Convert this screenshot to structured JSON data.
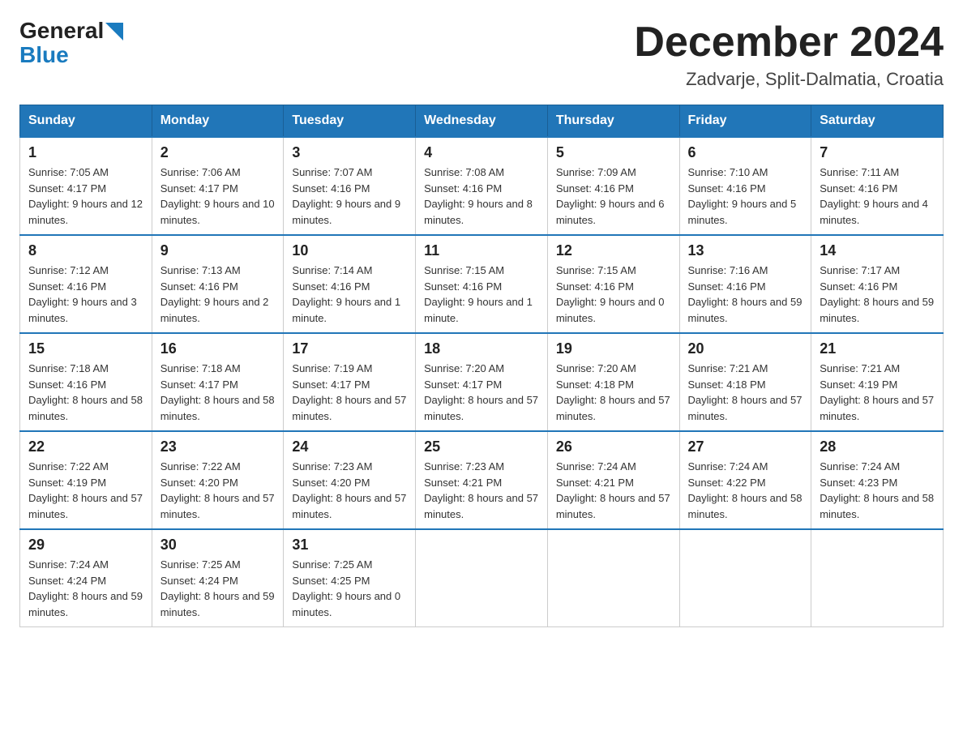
{
  "header": {
    "logo_general": "General",
    "logo_blue": "Blue",
    "title": "December 2024",
    "location": "Zadvarje, Split-Dalmatia, Croatia"
  },
  "days_of_week": [
    "Sunday",
    "Monday",
    "Tuesday",
    "Wednesday",
    "Thursday",
    "Friday",
    "Saturday"
  ],
  "weeks": [
    [
      {
        "day": "1",
        "sunrise": "7:05 AM",
        "sunset": "4:17 PM",
        "daylight": "9 hours and 12 minutes."
      },
      {
        "day": "2",
        "sunrise": "7:06 AM",
        "sunset": "4:17 PM",
        "daylight": "9 hours and 10 minutes."
      },
      {
        "day": "3",
        "sunrise": "7:07 AM",
        "sunset": "4:16 PM",
        "daylight": "9 hours and 9 minutes."
      },
      {
        "day": "4",
        "sunrise": "7:08 AM",
        "sunset": "4:16 PM",
        "daylight": "9 hours and 8 minutes."
      },
      {
        "day": "5",
        "sunrise": "7:09 AM",
        "sunset": "4:16 PM",
        "daylight": "9 hours and 6 minutes."
      },
      {
        "day": "6",
        "sunrise": "7:10 AM",
        "sunset": "4:16 PM",
        "daylight": "9 hours and 5 minutes."
      },
      {
        "day": "7",
        "sunrise": "7:11 AM",
        "sunset": "4:16 PM",
        "daylight": "9 hours and 4 minutes."
      }
    ],
    [
      {
        "day": "8",
        "sunrise": "7:12 AM",
        "sunset": "4:16 PM",
        "daylight": "9 hours and 3 minutes."
      },
      {
        "day": "9",
        "sunrise": "7:13 AM",
        "sunset": "4:16 PM",
        "daylight": "9 hours and 2 minutes."
      },
      {
        "day": "10",
        "sunrise": "7:14 AM",
        "sunset": "4:16 PM",
        "daylight": "9 hours and 1 minute."
      },
      {
        "day": "11",
        "sunrise": "7:15 AM",
        "sunset": "4:16 PM",
        "daylight": "9 hours and 1 minute."
      },
      {
        "day": "12",
        "sunrise": "7:15 AM",
        "sunset": "4:16 PM",
        "daylight": "9 hours and 0 minutes."
      },
      {
        "day": "13",
        "sunrise": "7:16 AM",
        "sunset": "4:16 PM",
        "daylight": "8 hours and 59 minutes."
      },
      {
        "day": "14",
        "sunrise": "7:17 AM",
        "sunset": "4:16 PM",
        "daylight": "8 hours and 59 minutes."
      }
    ],
    [
      {
        "day": "15",
        "sunrise": "7:18 AM",
        "sunset": "4:16 PM",
        "daylight": "8 hours and 58 minutes."
      },
      {
        "day": "16",
        "sunrise": "7:18 AM",
        "sunset": "4:17 PM",
        "daylight": "8 hours and 58 minutes."
      },
      {
        "day": "17",
        "sunrise": "7:19 AM",
        "sunset": "4:17 PM",
        "daylight": "8 hours and 57 minutes."
      },
      {
        "day": "18",
        "sunrise": "7:20 AM",
        "sunset": "4:17 PM",
        "daylight": "8 hours and 57 minutes."
      },
      {
        "day": "19",
        "sunrise": "7:20 AM",
        "sunset": "4:18 PM",
        "daylight": "8 hours and 57 minutes."
      },
      {
        "day": "20",
        "sunrise": "7:21 AM",
        "sunset": "4:18 PM",
        "daylight": "8 hours and 57 minutes."
      },
      {
        "day": "21",
        "sunrise": "7:21 AM",
        "sunset": "4:19 PM",
        "daylight": "8 hours and 57 minutes."
      }
    ],
    [
      {
        "day": "22",
        "sunrise": "7:22 AM",
        "sunset": "4:19 PM",
        "daylight": "8 hours and 57 minutes."
      },
      {
        "day": "23",
        "sunrise": "7:22 AM",
        "sunset": "4:20 PM",
        "daylight": "8 hours and 57 minutes."
      },
      {
        "day": "24",
        "sunrise": "7:23 AM",
        "sunset": "4:20 PM",
        "daylight": "8 hours and 57 minutes."
      },
      {
        "day": "25",
        "sunrise": "7:23 AM",
        "sunset": "4:21 PM",
        "daylight": "8 hours and 57 minutes."
      },
      {
        "day": "26",
        "sunrise": "7:24 AM",
        "sunset": "4:21 PM",
        "daylight": "8 hours and 57 minutes."
      },
      {
        "day": "27",
        "sunrise": "7:24 AM",
        "sunset": "4:22 PM",
        "daylight": "8 hours and 58 minutes."
      },
      {
        "day": "28",
        "sunrise": "7:24 AM",
        "sunset": "4:23 PM",
        "daylight": "8 hours and 58 minutes."
      }
    ],
    [
      {
        "day": "29",
        "sunrise": "7:24 AM",
        "sunset": "4:24 PM",
        "daylight": "8 hours and 59 minutes."
      },
      {
        "day": "30",
        "sunrise": "7:25 AM",
        "sunset": "4:24 PM",
        "daylight": "8 hours and 59 minutes."
      },
      {
        "day": "31",
        "sunrise": "7:25 AM",
        "sunset": "4:25 PM",
        "daylight": "9 hours and 0 minutes."
      },
      null,
      null,
      null,
      null
    ]
  ]
}
